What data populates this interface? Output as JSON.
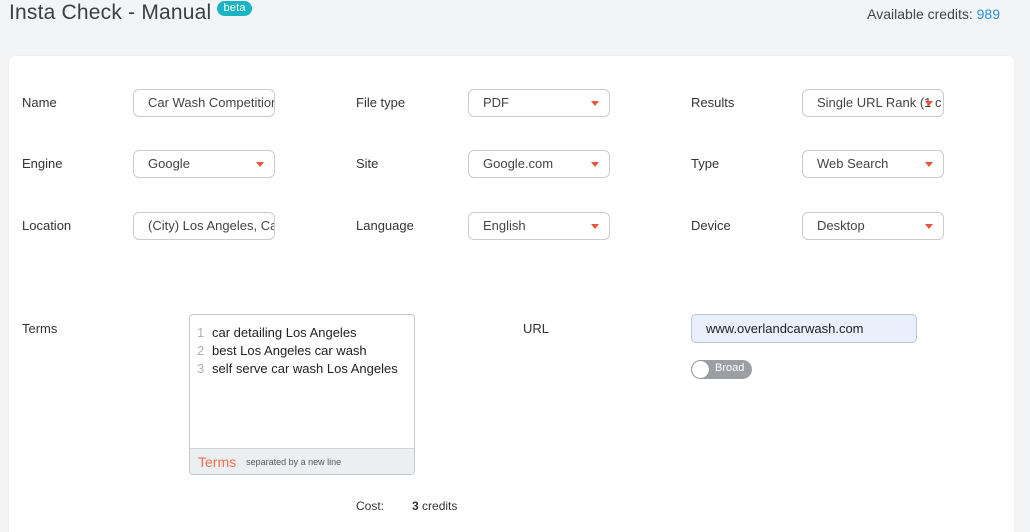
{
  "header": {
    "title": "Insta Check - Manual",
    "badge": "beta",
    "credits_label": "Available credits:",
    "credits_value": "989"
  },
  "form": {
    "name": {
      "label": "Name",
      "value": "Car Wash Competition"
    },
    "file_type": {
      "label": "File type",
      "value": "PDF"
    },
    "results": {
      "label": "Results",
      "value": "Single URL Rank (1 c"
    },
    "engine": {
      "label": "Engine",
      "value": "Google"
    },
    "site": {
      "label": "Site",
      "value": "Google.com"
    },
    "type": {
      "label": "Type",
      "value": "Web Search"
    },
    "location": {
      "label": "Location",
      "value": "(City) Los Angeles, Ca"
    },
    "language": {
      "label": "Language",
      "value": "English"
    },
    "device": {
      "label": "Device",
      "value": "Desktop"
    },
    "terms": {
      "label": "Terms",
      "items": [
        "car detailing Los Angeles",
        "best Los Angeles car wash",
        "self serve car wash Los Angeles"
      ],
      "footer_title": "Terms",
      "footer_hint": "separated by a new line"
    },
    "url": {
      "label": "URL",
      "value": "www.overlandcarwash.com"
    },
    "match": {
      "label": "Broad"
    },
    "cost": {
      "label": "Cost:",
      "value": "3",
      "unit": "credits"
    }
  },
  "colors": {
    "accent_orange": "#e8543a",
    "badge_teal": "#19b5c4",
    "credits_blue": "#2a8fd8"
  }
}
